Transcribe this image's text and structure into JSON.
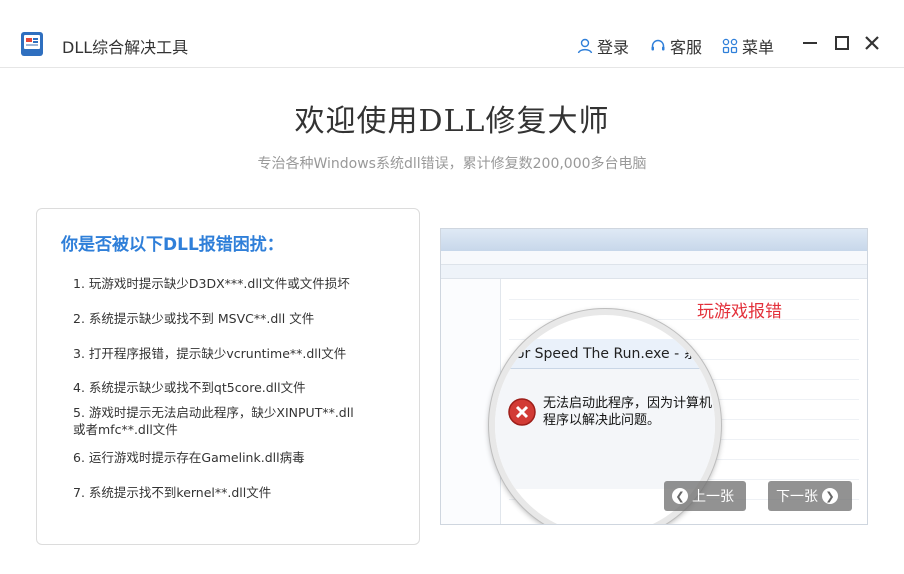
{
  "titlebar": {
    "app_title": "DLL综合解决工具",
    "login_label": "登录",
    "service_label": "客服",
    "menu_label": "菜单",
    "accent_color": "#2f7fd9"
  },
  "hero": {
    "title": "欢迎使用DLL修复大师",
    "subtitle": "专治各种Windows系统dll错误，累计修复数200,000多台电脑"
  },
  "card": {
    "title": "你是否被以下DLL报错困扰：",
    "issues": [
      "1. 玩游戏时提示缺少D3DX***.dll文件或文件损坏",
      "2. 系统提示缺少或找不到 MSVC**.dll 文件",
      "3. 打开程序报错，提示缺少vcruntime**.dll文件",
      "4. 系统提示缺少或找不到qt5core.dll文件",
      "5. 游戏时提示无法启动此程序，缺少XINPUT**.dll或者mfc**.dll文件",
      "6. 运行游戏时提示存在Gamelink.dll病毒",
      "7. 系统提示找不到kernel**.dll文件"
    ]
  },
  "screenshot": {
    "label": "玩游戏报错",
    "dialog_title": "d For Speed The Run.exe - 系统错误",
    "message_line1": "无法启动此程序，因为计算机中",
    "message_line2": "程序以解决此问题。",
    "label_color": "#e3313b"
  },
  "carousel": {
    "prev_label": "上一张",
    "next_label": "下一张"
  }
}
